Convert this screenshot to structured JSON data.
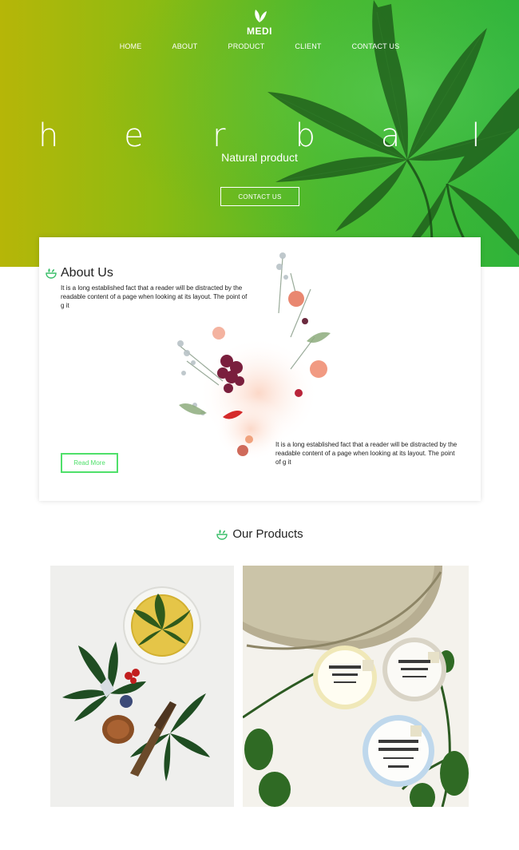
{
  "brand": {
    "name": "MEDI",
    "icon": "leaf-icon"
  },
  "nav": {
    "items": [
      "HOME",
      "ABOUT",
      "PRODUCT",
      "CLIENT",
      "CONTACT US"
    ]
  },
  "hero": {
    "title_letters": [
      "h",
      "e",
      "r",
      "b",
      "a",
      "l"
    ],
    "subtitle": "Natural product",
    "button_label": "CONTACT US",
    "colors": {
      "gradient_start": "#b6b608",
      "gradient_end": "#2fb33a"
    }
  },
  "about": {
    "title": "About Us",
    "text1": "It is a long established fact that a reader will be distracted by the readable content of a page when looking at its layout. The point of g it",
    "text2": "It is a long established fact that a reader will be distracted by the readable content of a page when looking at its layout. The point of g it",
    "read_more_label": "Read More",
    "accent": "#4fe06a"
  },
  "products": {
    "title": "Our Products",
    "items": [
      {
        "image": "herbal-tea-cannabis-leaves-photo"
      },
      {
        "image": "hemp-body-balm-jars-photo"
      }
    ]
  }
}
